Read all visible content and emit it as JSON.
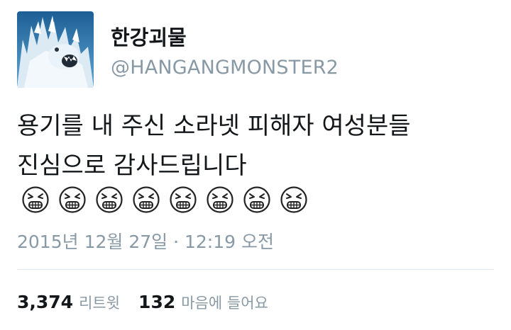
{
  "tweet": {
    "author": {
      "display_name": "한강괴물",
      "handle": "@HANGANGMONSTER2",
      "avatar": "snow-monster-avatar"
    },
    "text_lines": [
      "용기를 내 주신 소라넷 피해자 여성분들",
      "진심으로 감사드립니다"
    ],
    "emoji": {
      "name": "crying-face-icon",
      "count": 8
    },
    "timestamp": "2015년 12월 27일 · 12:19 오전",
    "stats": {
      "retweets": {
        "count": "3,374",
        "label": "리트윗"
      },
      "likes": {
        "count": "132",
        "label": "마음에 들어요"
      }
    }
  },
  "colors": {
    "primary_text": "#14171a",
    "secondary_text": "#8899a6",
    "divider": "#e1e8ed"
  }
}
